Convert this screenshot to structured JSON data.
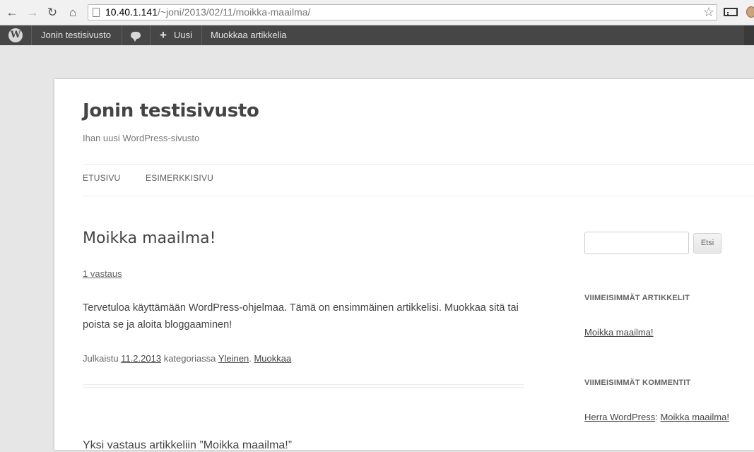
{
  "browser": {
    "url_host": "10.40.1.141",
    "url_path": "/~joni/2013/02/11/moikka-maailma/"
  },
  "adminbar": {
    "site_name": "Jonin testisivusto",
    "new_label": "Uusi",
    "edit_label": "Muokkaa artikkelia"
  },
  "site": {
    "title": "Jonin testisivusto",
    "description": "Ihan uusi WordPress-sivusto"
  },
  "menu": [
    "ETUSIVU",
    "ESIMERKKISIVU"
  ],
  "post": {
    "title": "Moikka maailma!",
    "comments_link": "1 vastaus",
    "content": "Tervetuloa käyttämään WordPress-ohjelmaa. Tämä on ensimmäinen artikkelisi. Muokkaa sitä tai poista se ja aloita bloggaaminen!",
    "meta_prefix": "Julkaistu",
    "date": "11.2.2013",
    "meta_category_prefix": "kategoriassa",
    "category": "Yleinen",
    "meta_sep": ".",
    "edit": "Muokkaa"
  },
  "comments": {
    "title": "Yksi vastaus artikkeliin ”Moikka maailma!”"
  },
  "sidebar": {
    "search_button": "Etsi",
    "recent_posts_title": "VIIMEISIMMÄT ARTIKKELIT",
    "recent_posts": [
      "Moikka maailma!"
    ],
    "recent_comments_title": "VIIMEISIMMÄT KOMMENTIT",
    "recent_comment": {
      "author": "Herra WordPress",
      "sep": ":",
      "post": "Moikka maailma!"
    }
  }
}
